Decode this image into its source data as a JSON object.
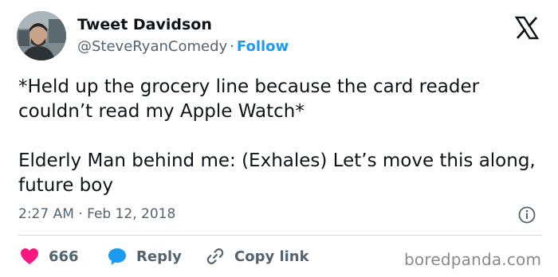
{
  "author": {
    "name": "Tweet Davidson",
    "handle": "@SteveRyanComedy",
    "separator": "·",
    "follow_label": "Follow"
  },
  "tweet": {
    "paragraph_1": "*Held up the grocery line because the card reader couldn’t read my Apple Watch*",
    "paragraph_2": "Elderly Man behind me: (Exhales) Let’s move this along, future boy",
    "time": "2:27 AM",
    "date_separator": "·",
    "date": "Feb 12, 2018"
  },
  "actions": {
    "like_count": "666",
    "reply_label": "Reply",
    "copy_label": "Copy link"
  },
  "watermark": "boredpanda.com",
  "colors": {
    "accent": "#1d9bf0",
    "like": "#f91880",
    "text": "#0f1419",
    "muted": "#536471",
    "divider": "#cfd9de"
  },
  "icons": {
    "brand": "x-logo-icon",
    "info": "info-icon",
    "like": "heart-icon",
    "reply": "speech-bubble-icon",
    "copy": "link-icon"
  }
}
